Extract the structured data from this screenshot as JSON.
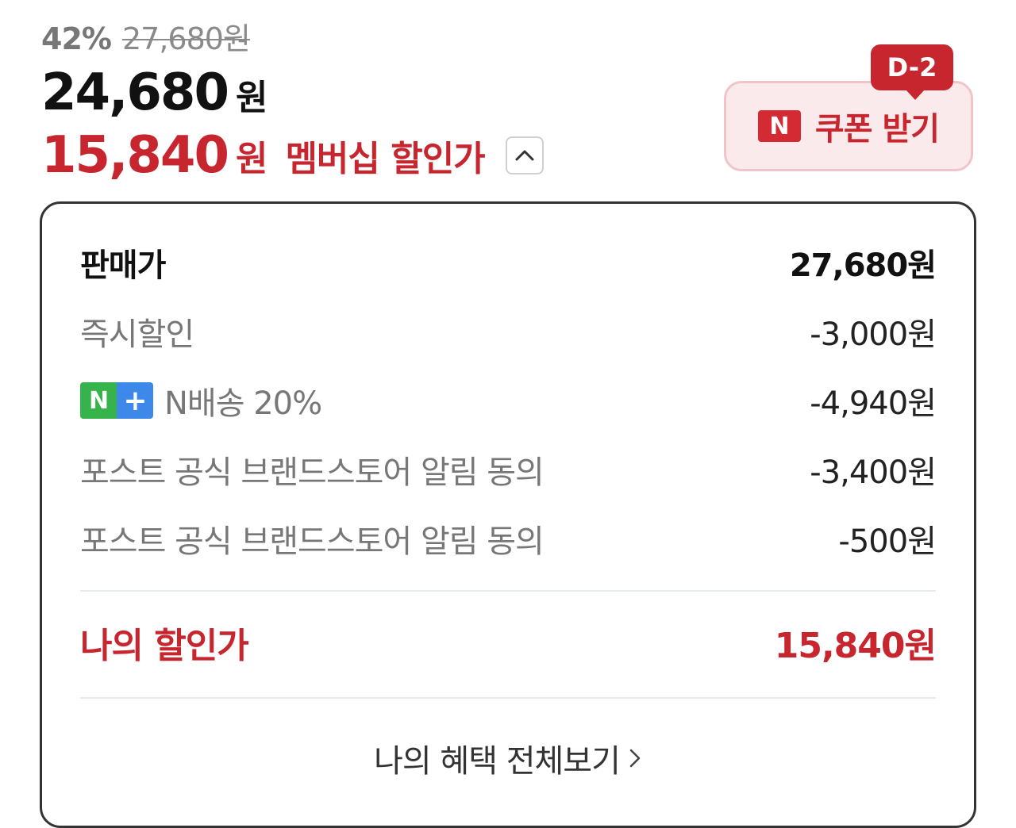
{
  "price": {
    "discount_percent": "42%",
    "original_price": "27,680원",
    "sale_price": "24,680",
    "sale_unit": "원",
    "member_price": "15,840",
    "member_unit": "원",
    "member_label": "멤버십 할인가",
    "toggle_icon": "chevron-up-icon"
  },
  "coupon": {
    "dday": "D-2",
    "logo_letter": "N",
    "label": "쿠폰 받기"
  },
  "breakdown": {
    "rows": [
      {
        "label": "판매가",
        "amount": "27,680원"
      },
      {
        "label": "즉시할인",
        "amount": "-3,000원"
      },
      {
        "badge_n": "N",
        "badge_plus": "+",
        "label": "N배송 20%",
        "amount": "-4,940원"
      },
      {
        "label": "포스트 공식 브랜드스토어 알림 동의",
        "amount": "-3,400원"
      },
      {
        "label": "포스트 공식 브랜드스토어 알림 동의",
        "amount": "-500원"
      }
    ],
    "total": {
      "label": "나의 할인가",
      "amount": "15,840원"
    },
    "more_link": "나의 혜택 전체보기"
  },
  "colors": {
    "accent_red": "#c8262f",
    "coupon_bg": "#fbeaec",
    "badge_green": "#36b34a",
    "badge_blue": "#3d88e8"
  }
}
